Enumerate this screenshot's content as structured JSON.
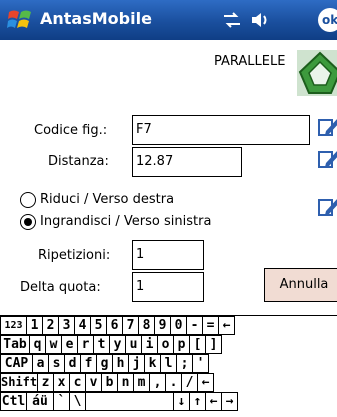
{
  "titlebar": {
    "app_title": "AntasMobile",
    "ok_label": "ok",
    "icons": [
      "windows-flag-icon",
      "network-icon",
      "volume-icon"
    ]
  },
  "header": {
    "label": "PARALLELE",
    "icon": "parallel-shape-icon"
  },
  "form": {
    "codice_label": "Codice fig.:",
    "codice_value": "F7",
    "distanza_label": "Distanza:",
    "distanza_value": "12.87",
    "radio_riduci": "Riduci / Verso destra",
    "radio_ingrandisci": "Ingrandisci / Verso sinistra",
    "ripetizioni_label": "Ripetizioni:",
    "ripetizioni_value": "1",
    "delta_label": "Delta quota:",
    "delta_value": "1",
    "annulla_label": "Annulla",
    "selected_radio": "ingrandisci"
  },
  "keyboard": {
    "rows": [
      [
        "123",
        "1",
        "2",
        "3",
        "4",
        "5",
        "6",
        "7",
        "8",
        "9",
        "0",
        "-",
        "=",
        "←"
      ],
      [
        "Tab",
        "q",
        "w",
        "e",
        "r",
        "t",
        "y",
        "u",
        "i",
        "o",
        "p",
        "[",
        "]"
      ],
      [
        "CAP",
        "a",
        "s",
        "d",
        "f",
        "g",
        "h",
        "j",
        "k",
        "l",
        ";",
        "'"
      ],
      [
        "Shift",
        "z",
        "x",
        "c",
        "v",
        "b",
        "n",
        "m",
        ",",
        ".",
        "/",
        "←"
      ],
      [
        "Ctl",
        "áü",
        "`",
        "\\",
        "",
        "↓",
        "↑",
        "←",
        "→"
      ]
    ]
  },
  "colors": {
    "titlebar": "#1a4f9e",
    "annulla_bg": "#f1dcd3",
    "shape_green": "#3d9a3d"
  }
}
